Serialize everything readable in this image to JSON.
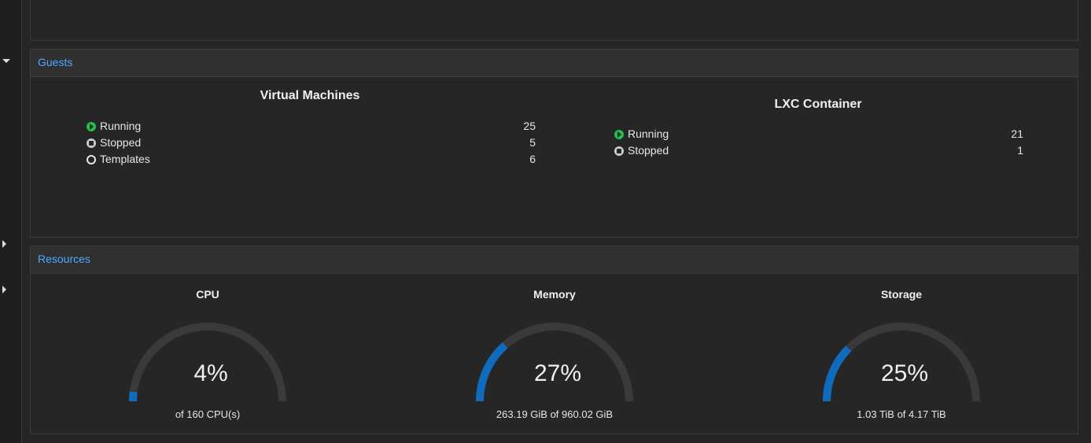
{
  "guests": {
    "header": "Guests",
    "vm": {
      "title": "Virtual Machines",
      "rows": [
        {
          "label": "Running",
          "count": "25",
          "status": "running"
        },
        {
          "label": "Stopped",
          "count": "5",
          "status": "stopped"
        },
        {
          "label": "Templates",
          "count": "6",
          "status": "template"
        }
      ]
    },
    "lxc": {
      "title": "LXC Container",
      "rows": [
        {
          "label": "Running",
          "count": "21",
          "status": "running"
        },
        {
          "label": "Stopped",
          "count": "1",
          "status": "stopped"
        }
      ]
    }
  },
  "resources": {
    "header": "Resources",
    "cpu": {
      "title": "CPU",
      "percent_text": "4%",
      "fraction": 0.04,
      "detail": "of 160 CPU(s)"
    },
    "memory": {
      "title": "Memory",
      "percent_text": "27%",
      "fraction": 0.27,
      "detail": "263.19 GiB of 960.02 GiB"
    },
    "storage": {
      "title": "Storage",
      "percent_text": "25%",
      "fraction": 0.25,
      "detail": "1.03 TiB of 4.17 TiB"
    }
  },
  "colors": {
    "accent": "#4ea8ff",
    "running": "#21bf4b",
    "gauge_fill": "#0f6cbd",
    "gauge_track": "#3a3a3a"
  }
}
